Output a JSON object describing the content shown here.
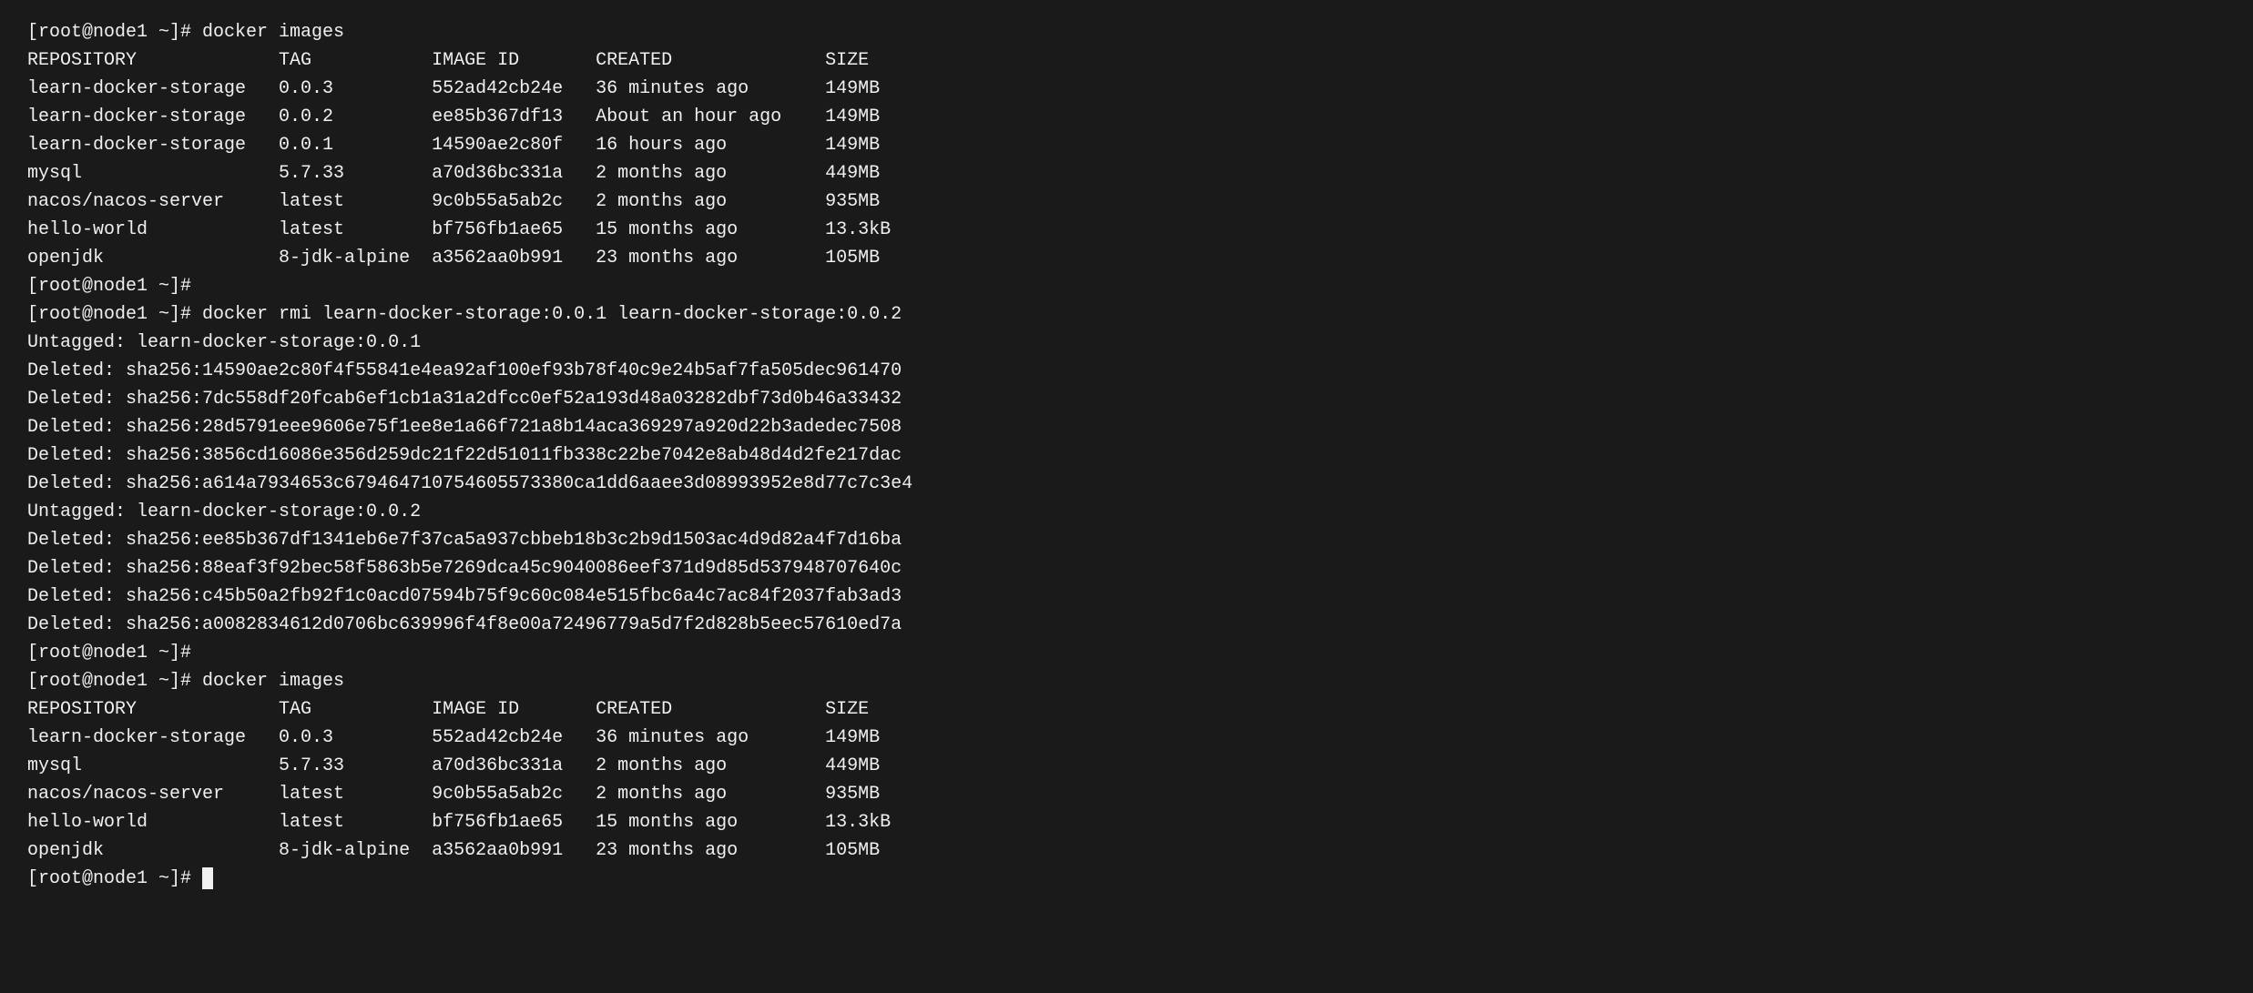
{
  "terminal": {
    "lines": [
      {
        "type": "prompt-cmd",
        "text": "[root@node1 ~]# docker images"
      },
      {
        "type": "header",
        "text": "REPOSITORY             TAG           IMAGE ID       CREATED              SIZE"
      },
      {
        "type": "data",
        "text": "learn-docker-storage   0.0.3         552ad42cb24e   36 minutes ago       149MB"
      },
      {
        "type": "data",
        "text": "learn-docker-storage   0.0.2         ee85b367df13   About an hour ago    149MB"
      },
      {
        "type": "data",
        "text": "learn-docker-storage   0.0.1         14590ae2c80f   16 hours ago         149MB"
      },
      {
        "type": "data",
        "text": "mysql                  5.7.33        a70d36bc331a   2 months ago         449MB"
      },
      {
        "type": "data",
        "text": "nacos/nacos-server     latest        9c0b55a5ab2c   2 months ago         935MB"
      },
      {
        "type": "data",
        "text": "hello-world            latest        bf756fb1ae65   15 months ago        13.3kB"
      },
      {
        "type": "data",
        "text": "openjdk                8-jdk-alpine  a3562aa0b991   23 months ago        105MB"
      },
      {
        "type": "prompt-cmd",
        "text": "[root@node1 ~]#"
      },
      {
        "type": "prompt-cmd",
        "text": "[root@node1 ~]# docker rmi learn-docker-storage:0.0.1 learn-docker-storage:0.0.2"
      },
      {
        "type": "data",
        "text": "Untagged: learn-docker-storage:0.0.1"
      },
      {
        "type": "data",
        "text": "Deleted: sha256:14590ae2c80f4f55841e4ea92af100ef93b78f40c9e24b5af7fa505dec961470"
      },
      {
        "type": "data",
        "text": "Deleted: sha256:7dc558df20fcab6ef1cb1a31a2dfcc0ef52a193d48a03282dbf73d0b46a33432"
      },
      {
        "type": "data",
        "text": "Deleted: sha256:28d5791eee9606e75f1ee8e1a66f721a8b14aca369297a920d22b3adedec7508"
      },
      {
        "type": "data",
        "text": "Deleted: sha256:3856cd16086e356d259dc21f22d51011fb338c22be7042e8ab48d4d2fe217dac"
      },
      {
        "type": "data",
        "text": "Deleted: sha256:a614a7934653c679464710754605573380ca1dd6aaee3d08993952e8d77c7c3e4"
      },
      {
        "type": "data",
        "text": "Untagged: learn-docker-storage:0.0.2"
      },
      {
        "type": "data",
        "text": "Deleted: sha256:ee85b367df1341eb6e7f37ca5a937cbbeb18b3c2b9d1503ac4d9d82a4f7d16ba"
      },
      {
        "type": "data",
        "text": "Deleted: sha256:88eaf3f92bec58f5863b5e7269dca45c9040086eef371d9d85d537948707640c"
      },
      {
        "type": "data",
        "text": "Deleted: sha256:c45b50a2fb92f1c0acd07594b75f9c60c084e515fbc6a4c7ac84f2037fab3ad3"
      },
      {
        "type": "data",
        "text": "Deleted: sha256:a0082834612d0706bc639996f4f8e00a72496779a5d7f2d828b5eec57610ed7a"
      },
      {
        "type": "prompt-cmd",
        "text": "[root@node1 ~]#"
      },
      {
        "type": "prompt-cmd",
        "text": "[root@node1 ~]# docker images"
      },
      {
        "type": "header",
        "text": "REPOSITORY             TAG           IMAGE ID       CREATED              SIZE"
      },
      {
        "type": "data",
        "text": "learn-docker-storage   0.0.3         552ad42cb24e   36 minutes ago       149MB"
      },
      {
        "type": "data",
        "text": "mysql                  5.7.33        a70d36bc331a   2 months ago         449MB"
      },
      {
        "type": "data",
        "text": "nacos/nacos-server     latest        9c0b55a5ab2c   2 months ago         935MB"
      },
      {
        "type": "data",
        "text": "hello-world            latest        bf756fb1ae65   15 months ago        13.3kB"
      },
      {
        "type": "data",
        "text": "openjdk                8-jdk-alpine  a3562aa0b991   23 months ago        105MB"
      },
      {
        "type": "prompt-cursor",
        "text": "[root@node1 ~]# "
      }
    ]
  }
}
